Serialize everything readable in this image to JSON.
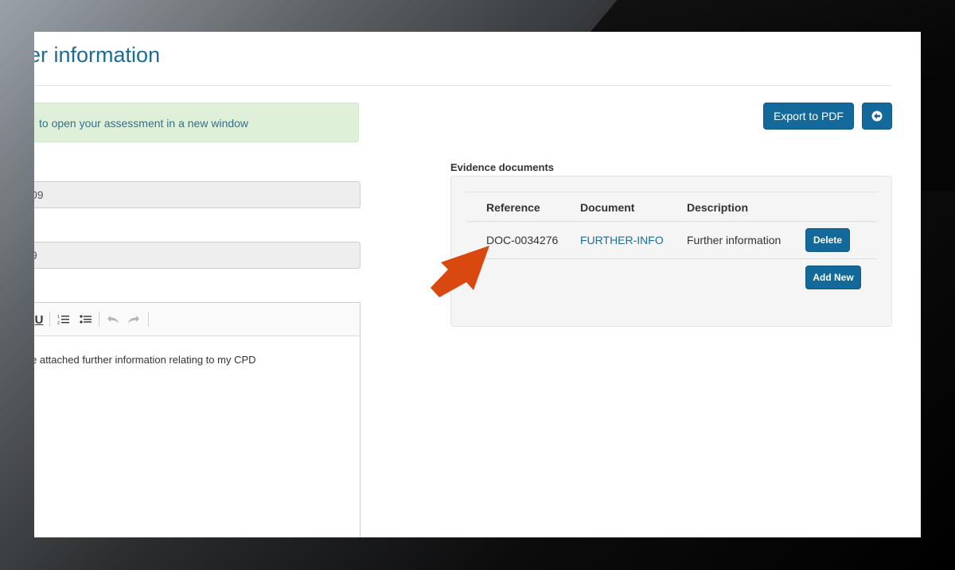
{
  "page": {
    "title": "her information"
  },
  "alert": {
    "text": "to open your assessment in a new window"
  },
  "fields": [
    {
      "value": "09"
    },
    {
      "value": "9"
    }
  ],
  "editor": {
    "toolbar": {
      "underline_label": "U"
    },
    "body_text": "e attached further information relating to my CPD"
  },
  "actions": {
    "export_label": "Export to PDF"
  },
  "evidence": {
    "section_label": "Evidence documents",
    "columns": [
      "Reference",
      "Document",
      "Description"
    ],
    "rows": [
      {
        "reference": "DOC-0034276",
        "document": "FURTHER-INFO",
        "description": "Further information",
        "delete_label": "Delete"
      }
    ],
    "add_new_label": "Add New"
  },
  "colors": {
    "accent": "#13699a",
    "title": "#1b6d96",
    "alert_bg": "#dff0d8",
    "pointer_arrow": "#d9480f"
  },
  "icons": {
    "back": "circle-arrow-left-icon",
    "pointer": "annotation-arrow-icon"
  }
}
